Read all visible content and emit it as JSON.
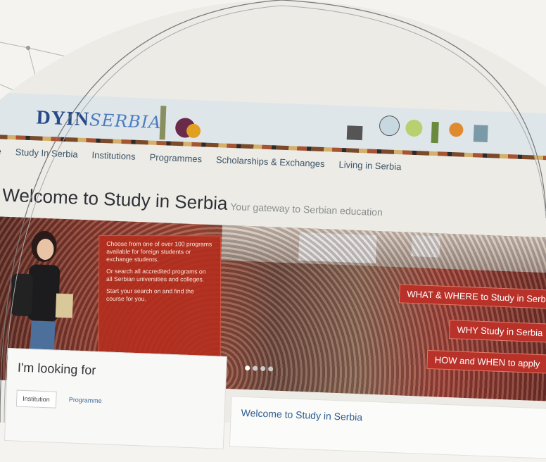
{
  "logo": {
    "prefix": "DYIN",
    "script": "SERBIA"
  },
  "nav": {
    "items": [
      "me",
      "Study In Serbia",
      "Institutions",
      "Programmes",
      "Scholarships & Exchanges",
      "Living in Serbia"
    ]
  },
  "page": {
    "title": "Welcome to Study in Serbia",
    "subtitle": "Your gateway to Serbian education"
  },
  "hero": {
    "intro_lines": [
      "Choose from one of over 100 programs available for foreign students or exchange students.",
      "Or search all accredited programs on all Serbian universities and colleges.",
      "Start your search on and find the course for you."
    ],
    "ribbons": [
      "WHAT & WHERE to Study in Serbia",
      "WHY Study in Serbia",
      "HOW and WHEN to apply"
    ]
  },
  "search_panel": {
    "title": "I'm looking for",
    "tabs": [
      "Institution",
      "Programme"
    ]
  },
  "welcome_box": {
    "title": "Welcome to Study in Serbia"
  },
  "colors": {
    "accent_red": "#b9322a",
    "nav_text": "#3c5568",
    "link_blue": "#2d5d8f"
  }
}
